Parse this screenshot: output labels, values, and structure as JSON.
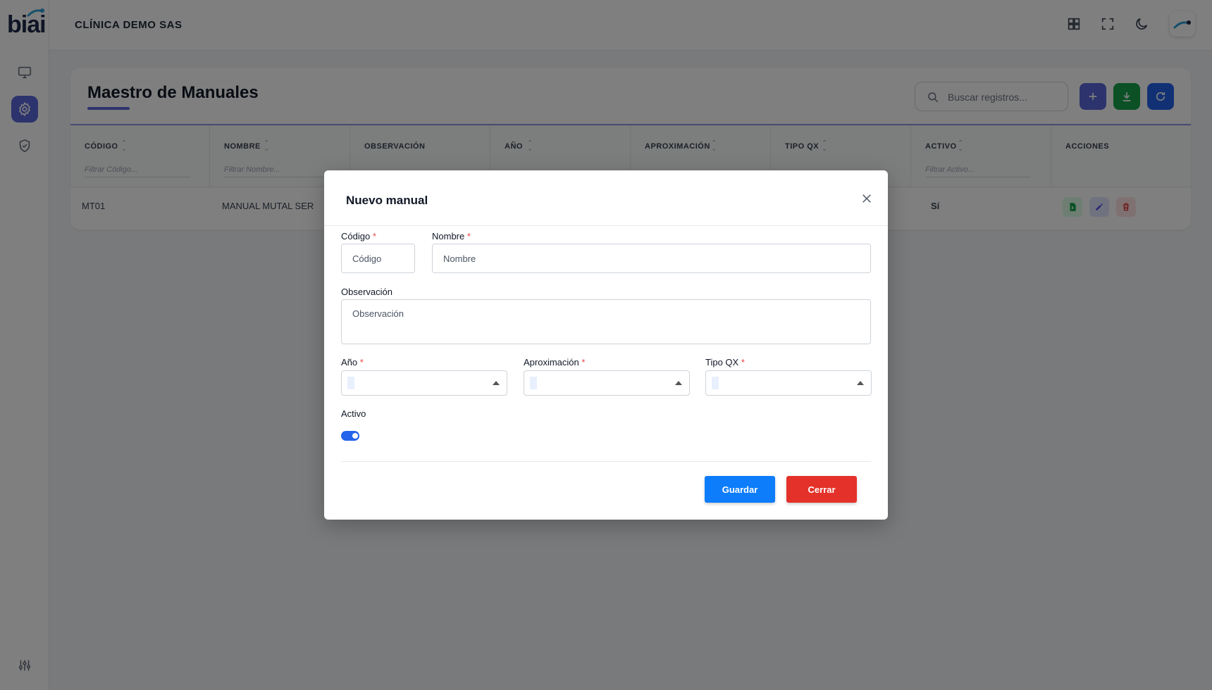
{
  "app": {
    "logo_text": "biai",
    "company": "CLÍNICA DEMO SAS"
  },
  "sidebar": {
    "items": [
      {
        "icon": "monitor-icon"
      },
      {
        "icon": "gear-icon",
        "active": true
      },
      {
        "icon": "shield-check-icon"
      },
      {
        "icon": "sliders-icon"
      }
    ]
  },
  "topbar": {
    "icons": [
      "grid-icon",
      "fullscreen-icon",
      "moon-icon",
      "user-avatar"
    ]
  },
  "page": {
    "title": "Maestro de Manuales",
    "search_placeholder": "Buscar registros...",
    "toolbar": [
      "add-icon",
      "download-icon",
      "refresh-icon"
    ],
    "toolbar_colors": [
      "#5a67d8",
      "#16a34a",
      "#2563eb"
    ],
    "columns": [
      {
        "label": "CÓDIGO",
        "filter": "Filtrar Código..."
      },
      {
        "label": "NOMBRE",
        "filter": "Filtrar Nombre..."
      },
      {
        "label": "OBSERVACIÓN",
        "filter": ""
      },
      {
        "label": "AÑO",
        "filter": ""
      },
      {
        "label": "APROXIMACIÓN",
        "filter": ""
      },
      {
        "label": "TIPO QX",
        "filter": ""
      },
      {
        "label": "ACTIVO",
        "filter": "Filtrar Activo..."
      },
      {
        "label": "ACCIONES",
        "filter": ""
      }
    ],
    "rows": [
      {
        "codigo": "MT01",
        "nombre": "MANUAL MUTAL SER",
        "activo": "Sí"
      }
    ]
  },
  "modal": {
    "title": "Nuevo manual",
    "fields": {
      "codigo": {
        "label": "Código",
        "required": "*",
        "placeholder": "Código",
        "value": ""
      },
      "nombre": {
        "label": "Nombre",
        "required": "*",
        "placeholder": "Nombre",
        "value": ""
      },
      "observacion": {
        "label": "Observación",
        "placeholder": "Observación",
        "value": ""
      },
      "anio": {
        "label": "Año",
        "required": "*",
        "value": ""
      },
      "aproximacion": {
        "label": "Aproximación",
        "required": "*",
        "value": ""
      },
      "tipo_qx": {
        "label": "Tipo QX",
        "required": "*",
        "value": ""
      },
      "activo": {
        "label": "Activo",
        "checked": true
      }
    },
    "buttons": {
      "save": "Guardar",
      "close": "Cerrar"
    },
    "colors": {
      "save": "#0d7dfc",
      "close": "#e4322b"
    }
  }
}
